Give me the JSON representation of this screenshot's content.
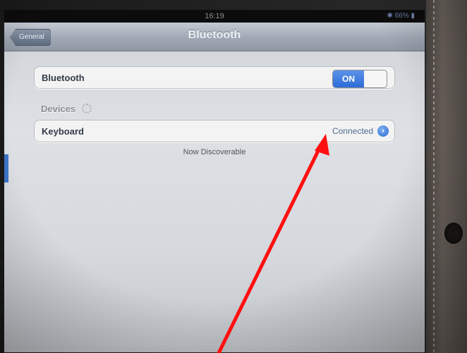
{
  "status_bar": {
    "time": "16:19",
    "battery": "✱ 66% ▮"
  },
  "nav": {
    "back_label": "General",
    "title": "Bluetooth"
  },
  "bluetooth_row": {
    "label": "Bluetooth",
    "toggle_label": "ON"
  },
  "devices": {
    "header": "Devices",
    "items": [
      {
        "name": "Keyboard",
        "status": "Connected"
      }
    ],
    "footer": "Now Discoverable"
  },
  "colors": {
    "annotation_arrow": "#ff1010",
    "toggle_on": "#2d6cd8"
  }
}
